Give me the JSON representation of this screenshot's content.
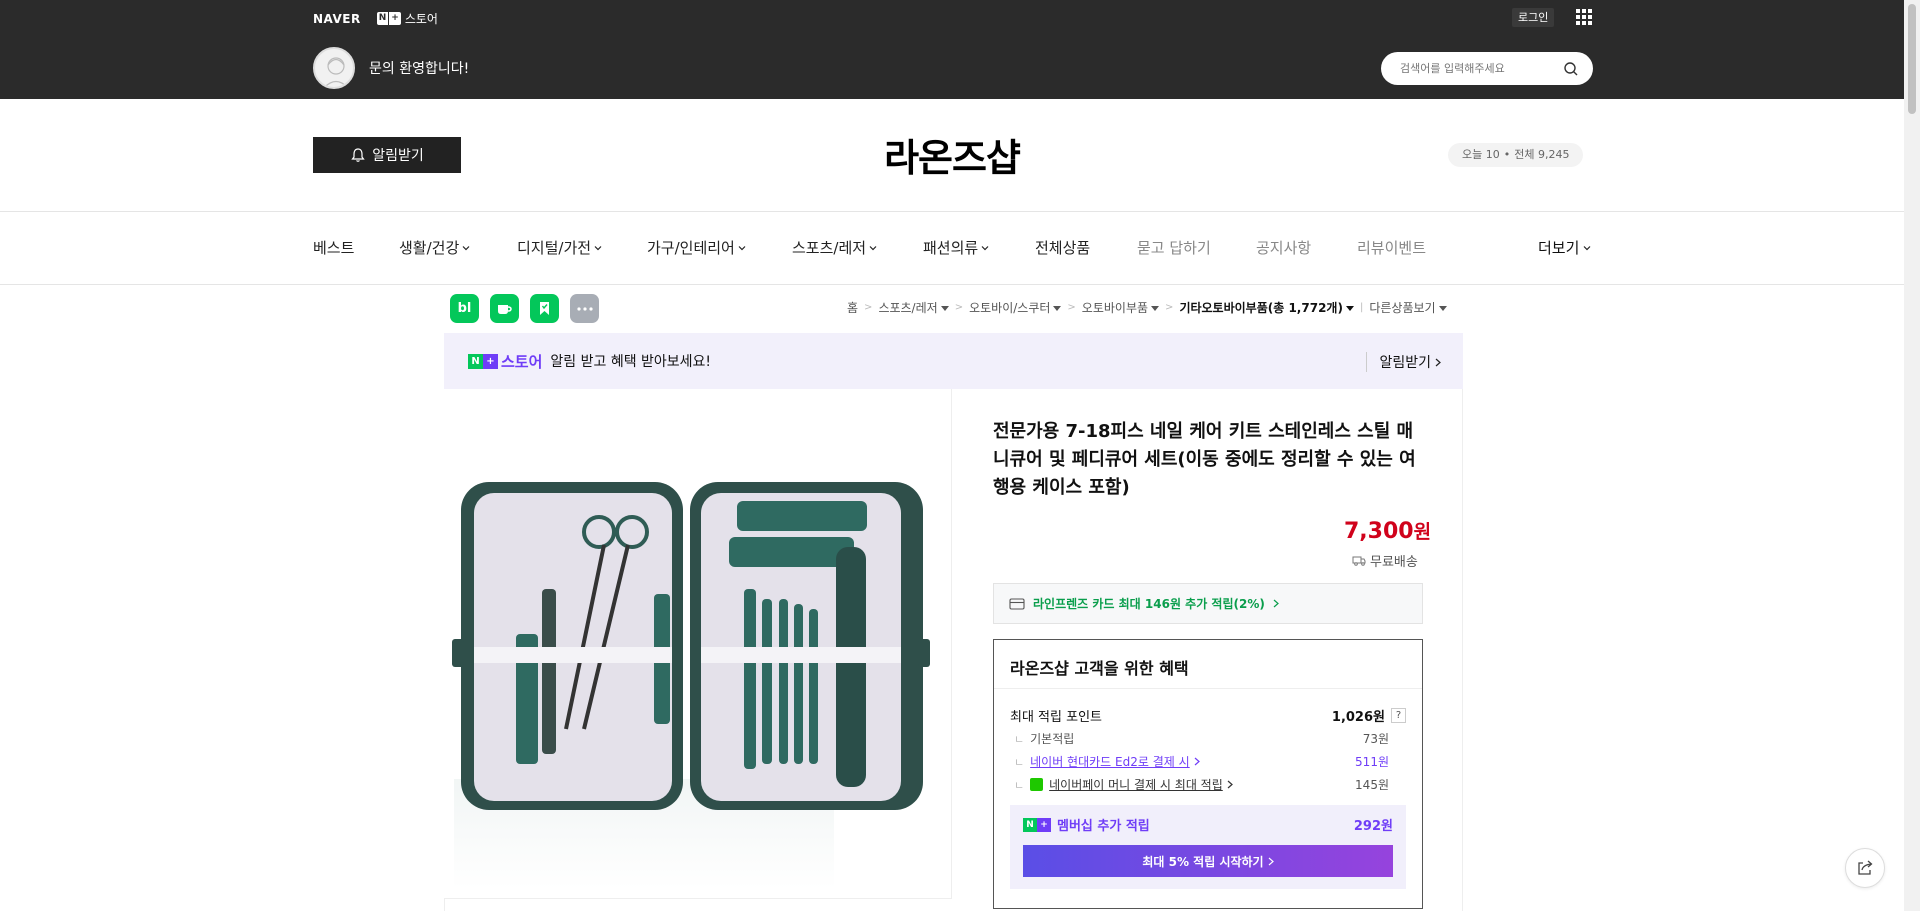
{
  "header": {
    "naver_logo": "NAVER",
    "nplus_n": "N",
    "nplus_plus": "+",
    "store_label": "스토어",
    "login": "로그인",
    "welcome": "문의 환영합니다!",
    "search_placeholder": "검색어를 입력해주세요"
  },
  "store": {
    "alarm_button": "알림받기",
    "title": "라온즈샵",
    "today_label": "오늘 10",
    "dot": "•",
    "total_label": "전체 9,245"
  },
  "nav": {
    "items": [
      {
        "label": "베스트"
      },
      {
        "label": "생활/건강"
      },
      {
        "label": "디지털/가전"
      },
      {
        "label": "가구/인테리어"
      },
      {
        "label": "스포츠/레저"
      },
      {
        "label": "패션의류"
      },
      {
        "label": "전체상품"
      },
      {
        "label": "묻고 답하기"
      },
      {
        "label": "공지사항"
      },
      {
        "label": "리뷰이벤트"
      }
    ],
    "more": "더보기"
  },
  "sns": {
    "blog": "bl",
    "cafe": "☕",
    "bookmark": "▮"
  },
  "breadcrumb": {
    "home": "홈",
    "c1": "스포츠/레저",
    "c2": "오토바이/스쿠터",
    "c3": "오토바이부품",
    "c4": "기타오토바이부품(총 1,772개)",
    "other": "다른상품보기",
    "sep": ">"
  },
  "promo": {
    "store": "스토어",
    "text": "알림 받고 혜택 받아보세요!",
    "alarm": "알림받기"
  },
  "product": {
    "title": "전문가용 7-18피스 네일 케어 키트 스테인레스 스틸 매니큐어 및 페디큐어 세트(이동 중에도 정리할 수 있는 여행용 케이스 포함)",
    "price": "7,300",
    "won": "원",
    "shipping": "무료배송",
    "card_promo": "라인프렌즈 카드 최대 146원 추가 적립(2%)"
  },
  "benefit": {
    "title": "라온즈샵 고객을 위한 혜택",
    "max_points_label": "최대 적립 포인트",
    "max_points": "1,026원",
    "help": "?",
    "tree": "ㄴ",
    "basic_label": "기본적립",
    "basic_amt": "73원",
    "hyundai_label": "네이버 현대카드 Ed2로 결제 시",
    "hyundai_amt": "511원",
    "pay_label": "네이버페이 머니 결제 시 최대 적립",
    "pay_amt": "145원",
    "member_label": "멤버십 추가 적립",
    "member_amt": "292원",
    "member_button": "최대 5% 적립 시작하기"
  },
  "colors": {
    "naver_green": "#03c75a",
    "nplus_purple": "#6f3df7",
    "price_red": "#d0021b",
    "dark_band": "#2b2b2b"
  }
}
